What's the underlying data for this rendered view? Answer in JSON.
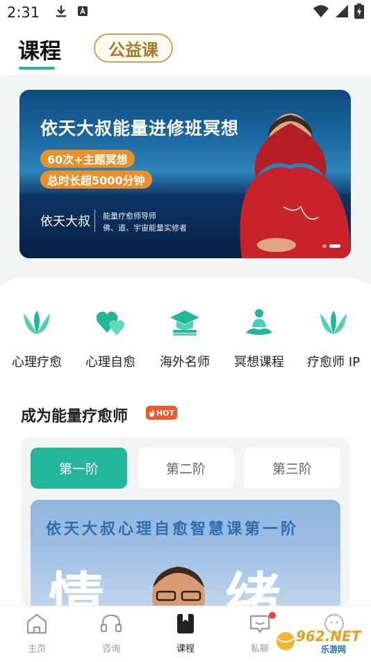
{
  "status_bar": {
    "time": "2:31",
    "icons": [
      "download-icon",
      "translate-icon",
      "wifi-icon",
      "signal-icon",
      "battery-charging-icon"
    ]
  },
  "header": {
    "tabs": [
      {
        "label": "课程",
        "active": true
      },
      {
        "label": "公益课",
        "active": false
      }
    ],
    "accent_color": "#23b69a"
  },
  "banner": {
    "title": "依天大叔能量进修班冥想",
    "tags": [
      "60次+主题冥想",
      "总时长超5000分钟"
    ],
    "name": "依天大叔",
    "role_line1": "能量疗愈师导师",
    "role_line2": "佛、道、宇宙能量实修者",
    "slide_count": 2,
    "active_slide": 2
  },
  "categories": [
    {
      "label": "心理疗愈",
      "icon": "tulip-icon"
    },
    {
      "label": "心理自愈",
      "icon": "hearts-icon"
    },
    {
      "label": "海外名师",
      "icon": "graduation-cap-icon"
    },
    {
      "label": "冥想课程",
      "icon": "meditation-icon"
    },
    {
      "label": "疗愈师 IP",
      "icon": "tulip-icon"
    }
  ],
  "section": {
    "title": "成为能量疗愈师",
    "badge": "HOT",
    "stages": [
      {
        "label": "第一阶",
        "active": true
      },
      {
        "label": "第二阶",
        "active": false
      },
      {
        "label": "第三阶",
        "active": false
      }
    ],
    "cover": {
      "title": "依天大叔心理自愈智慧课第一阶",
      "big_left": "情",
      "big_right": "绪"
    }
  },
  "bottom_nav": {
    "items": [
      {
        "label": "主页",
        "icon": "home-icon",
        "active": false
      },
      {
        "label": "咨询",
        "icon": "headset-icon",
        "active": false
      },
      {
        "label": "课程",
        "icon": "bookmark-book-icon",
        "active": true
      },
      {
        "label": "私聊",
        "icon": "chat-bubble-icon",
        "active": false,
        "has_notification": true
      },
      {
        "label": "",
        "icon": "profile-icon",
        "active": false
      }
    ]
  },
  "watermark": {
    "main": "962.NET",
    "sub": "乐游网"
  }
}
